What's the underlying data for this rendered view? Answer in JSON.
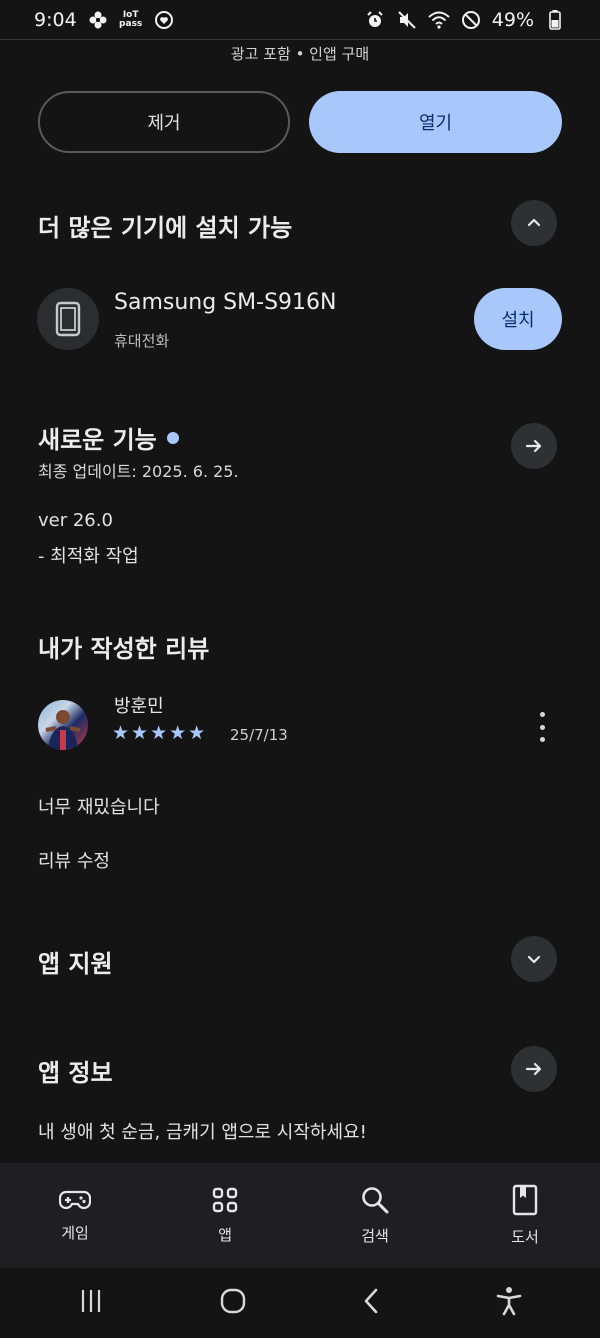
{
  "status_bar": {
    "time": "9:04",
    "iot_badge": "IoT\npass",
    "battery": "49%",
    "left_icons": [
      "flower-icon",
      "iot-pass-icon",
      "heart-shield-icon"
    ],
    "right_icons": [
      "alarm-icon",
      "mute-icon",
      "wifi-icon",
      "no-disturb-icon",
      "battery-icon"
    ]
  },
  "app_meta": "광고 포함 • 인앱 구매",
  "actions": {
    "remove_label": "제거",
    "open_label": "열기"
  },
  "more_devices": {
    "title": "더 많은 기기에 설치 가능",
    "device_name": "Samsung SM-S916N",
    "device_type": "휴대전화",
    "install_label": "설치"
  },
  "whats_new": {
    "title": "새로운 기능",
    "updated": "최종 업데이트: 2025. 6. 25.",
    "version": "ver 26.0",
    "notes": "- 최적화 작업"
  },
  "my_review": {
    "title": "내가 작성한 리뷰",
    "reviewer": "방훈민",
    "rating": 5,
    "stars": "★★★★★",
    "date": "25/7/13",
    "text": "너무 재밌습니다",
    "edit_label": "리뷰 수정"
  },
  "app_support": {
    "title": "앱 지원"
  },
  "app_info": {
    "title": "앱 정보",
    "description": "내 생애 첫 순금, 금캐기 앱으로 시작하세요!"
  },
  "bottom_nav": {
    "items": [
      {
        "label": "게임",
        "icon": "gamepad-icon"
      },
      {
        "label": "앱",
        "icon": "apps-grid-icon"
      },
      {
        "label": "검색",
        "icon": "search-icon"
      },
      {
        "label": "도서",
        "icon": "book-icon"
      }
    ]
  },
  "colors": {
    "accent": "#a8c7fa",
    "accent_text": "#062e6f",
    "background": "#141414"
  }
}
